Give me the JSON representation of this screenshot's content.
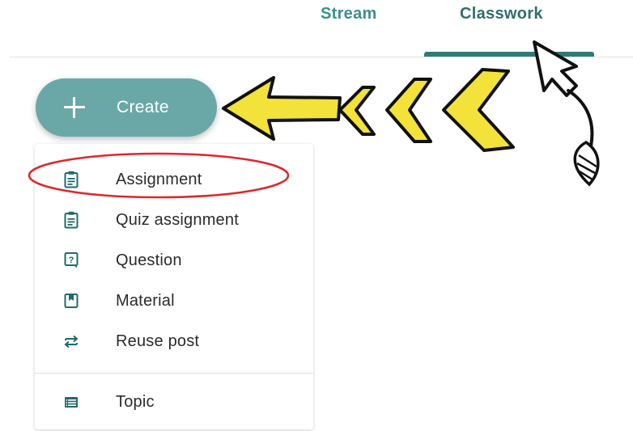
{
  "tabs": [
    {
      "label": "Stream"
    },
    {
      "label": "Classwork",
      "active": true
    }
  ],
  "create_button": {
    "label": "Create",
    "icon": "plus-icon"
  },
  "menu": {
    "items": [
      {
        "label": "Assignment",
        "icon": "assignment-icon",
        "highlighted": true
      },
      {
        "label": "Quiz assignment",
        "icon": "quiz-assignment-icon"
      },
      {
        "label": "Question",
        "icon": "question-icon"
      },
      {
        "label": "Material",
        "icon": "material-icon"
      },
      {
        "label": "Reuse post",
        "icon": "reuse-post-icon"
      },
      {
        "label": "Topic",
        "icon": "topic-icon"
      }
    ]
  },
  "colors": {
    "accent": "#6aa8a8",
    "tab_text": "#2f6e6e",
    "icon": "#1f6b6b",
    "arrow_fill": "#f2e23a",
    "highlight_circle": "#e0262b"
  }
}
